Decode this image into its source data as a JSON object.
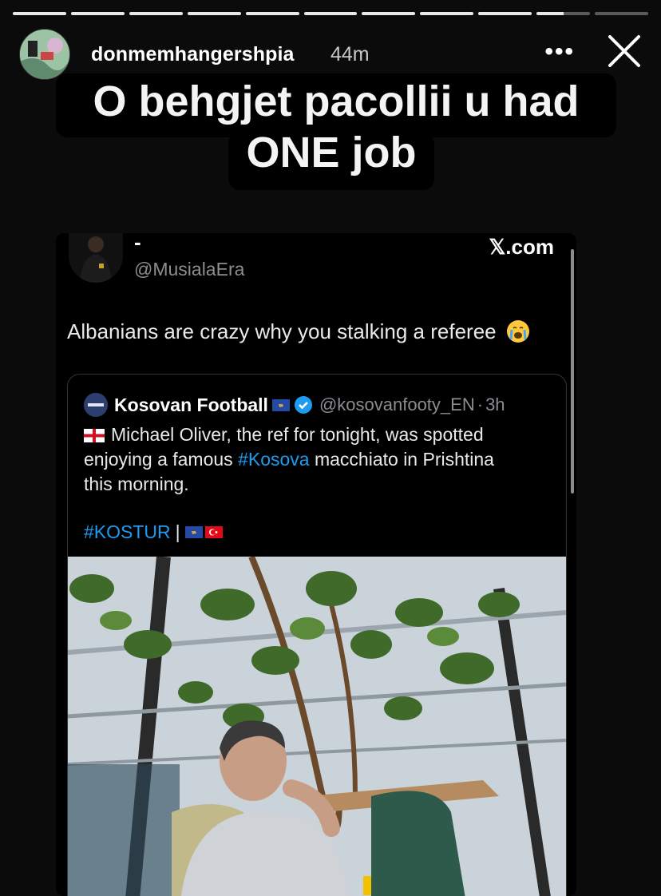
{
  "story": {
    "segments_total": 11,
    "current_segment": 10,
    "current_segment_progress": 0.5,
    "username": "donmemhangershpia",
    "time_ago": "44m",
    "more_label": "•••",
    "close_icon": "close-icon",
    "caption_lines": [
      "O behgjet pacollii u had",
      "ONE job"
    ]
  },
  "tweet": {
    "author_name": "-",
    "author_handle": "@MusialaEra",
    "source": "𝕏.com",
    "text": "Albanians are crazy why you stalking a referee",
    "emoji_icon": "crying-face-icon"
  },
  "quoted_tweet": {
    "author_name": "Kosovan Football",
    "author_handle": "@kosovanfooty_EN",
    "separator": "·",
    "time": "3h",
    "text_line1_pre": "Michael Oliver, the ref for tonight, was spotted",
    "text_line2_pre": "enjoying a famous ",
    "text_line2_hashtag": "#Kosova",
    "text_line2_post": " macchiato in Prishtina",
    "text_line3": "this morning.",
    "tags_hashtag": "#KOSTUR",
    "tags_separator": "|",
    "image_description_icon": "cafe-photo"
  },
  "colors": {
    "background": "#0b0b0b",
    "hashtag": "#1d9bf0",
    "verified": "#1d9bf0",
    "secondary_text": "#8a8d91"
  }
}
